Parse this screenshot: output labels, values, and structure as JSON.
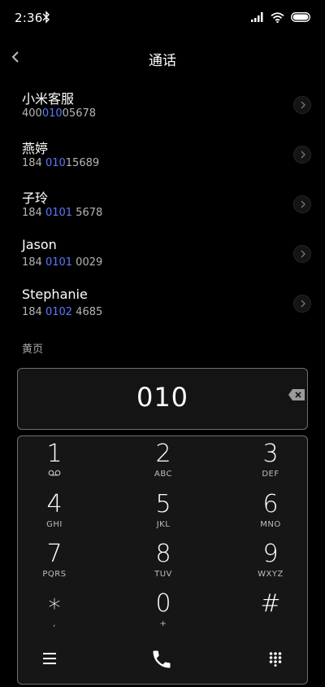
{
  "status": {
    "time": "2:36"
  },
  "header": {
    "title": "通话"
  },
  "contacts": [
    {
      "name": "小米客服",
      "num_pre": "400",
      "num_hl": "010",
      "num_post": "05678"
    },
    {
      "name": "燕婷",
      "num_pre": "184 ",
      "num_hl": "010",
      "num_post": "15689"
    },
    {
      "name": "子玲",
      "num_pre": "184 ",
      "num_hl": "0101",
      "num_post": " 5678"
    },
    {
      "name": "Jason",
      "num_pre": "184 ",
      "num_hl": "0101",
      "num_post": " 0029"
    },
    {
      "name": "Stephanie",
      "num_pre": "184 ",
      "num_hl": "0102",
      "num_post": " 4685"
    }
  ],
  "section_label": "黄页",
  "dialer": {
    "input": "010"
  },
  "keys": [
    {
      "num": "1",
      "sub": ""
    },
    {
      "num": "2",
      "sub": "ABC"
    },
    {
      "num": "3",
      "sub": "DEF"
    },
    {
      "num": "4",
      "sub": "GHI"
    },
    {
      "num": "5",
      "sub": "JKL"
    },
    {
      "num": "6",
      "sub": "MNO"
    },
    {
      "num": "7",
      "sub": "PQRS"
    },
    {
      "num": "8",
      "sub": "TUV"
    },
    {
      "num": "9",
      "sub": "WXYZ"
    },
    {
      "num": "∗",
      "sub": ","
    },
    {
      "num": "0",
      "sub": "+"
    },
    {
      "num": "#",
      "sub": ""
    }
  ],
  "colors": {
    "highlight": "#5b79ff",
    "background": "#000000"
  },
  "icons": [
    "bluetooth-icon",
    "signal-icon",
    "wifi-icon",
    "battery-icon",
    "back-icon",
    "chevron-right-icon",
    "backspace-icon",
    "voicemail-icon",
    "menu-icon",
    "phone-icon",
    "dialpad-icon"
  ]
}
